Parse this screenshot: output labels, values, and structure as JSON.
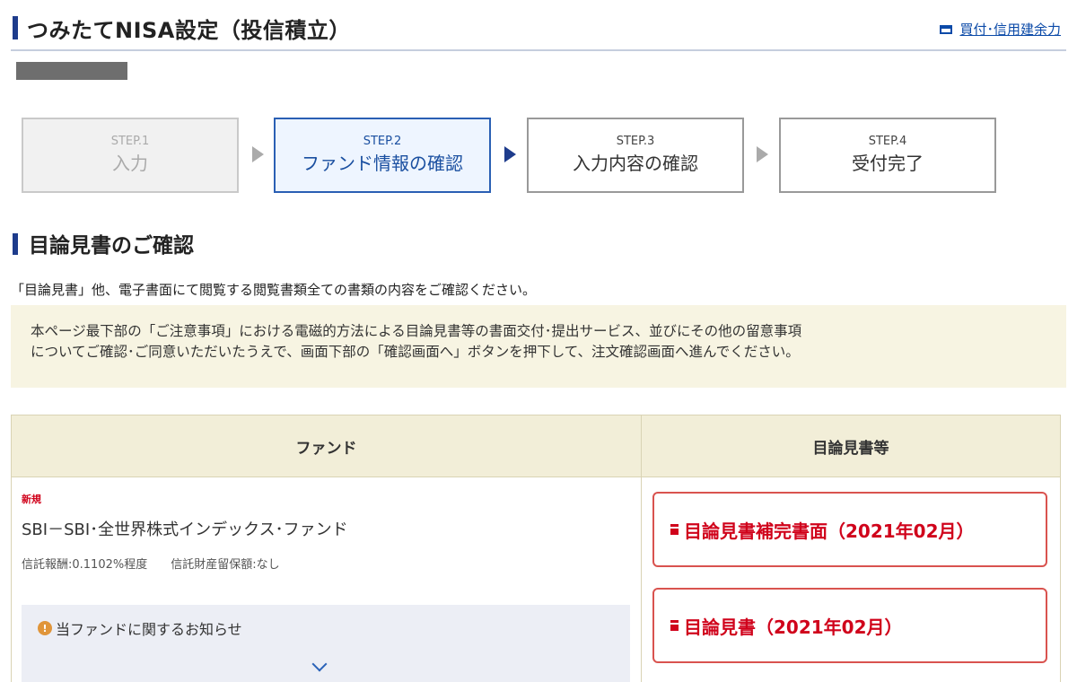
{
  "header": {
    "title": "つみたてNISA設定（投信積立）",
    "link_label": "買付･信用建余力"
  },
  "steps": [
    {
      "num": "STEP.1",
      "label": "入力",
      "state": "done"
    },
    {
      "num": "STEP.2",
      "label": "ファンド情報の確認",
      "state": "current"
    },
    {
      "num": "STEP.3",
      "label": "入力内容の確認",
      "state": "upcoming"
    },
    {
      "num": "STEP.4",
      "label": "受付完了",
      "state": "upcoming"
    }
  ],
  "section": {
    "title": "目論見書のご確認",
    "description": "「目論見書」他、電子書面にて閲覧する閲覧書類全ての書類の内容をご確認ください。",
    "notice_line1": "本ページ最下部の「ご注意事項」における電磁的方法による目論見書等の書面交付･提出サービス、並びにその他の留意事項",
    "notice_line2": "についてご確認･ご同意いただいたうえで、画面下部の「確認画面へ」ボタンを押下して、注文確認画面へ進んでください。"
  },
  "table": {
    "headers": [
      "ファンド",
      "目論見書等"
    ],
    "fund": {
      "badge": "新規",
      "name": "SBI－SBI･全世界株式インデックス･ファンド",
      "fee_info": "信託報酬:0.1102%程度　　信託財産留保額:なし",
      "news_label": "当ファンドに関するお知らせ"
    },
    "documents": [
      {
        "label": "目論見書補完書面（2021年02月）"
      },
      {
        "label": "目論見書（2021年02月）"
      }
    ]
  },
  "colors": {
    "brand_blue": "#1e3c8c",
    "link_blue": "#0b4aa8",
    "doc_red": "#d0021b",
    "notice_bg": "#f7f4e2",
    "table_header_bg": "#f2eed8"
  },
  "icons": [
    "window-icon",
    "info-icon",
    "chevron-down-icon",
    "document-icon"
  ]
}
